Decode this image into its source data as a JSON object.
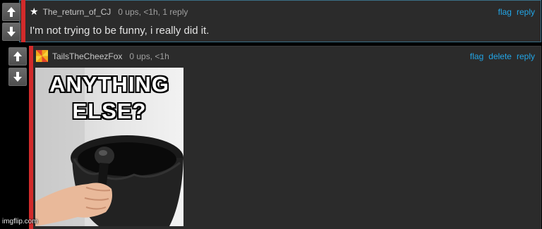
{
  "comments": [
    {
      "username": "The_return_of_CJ",
      "meta": "0 ups, <1h, 1 reply",
      "text": "I'm not trying to be funny, i really did it.",
      "actions": [
        "flag",
        "reply"
      ]
    },
    {
      "username": "TailsTheCheezFox",
      "meta": "0 ups, <1h",
      "actions": [
        "flag",
        "delete",
        "reply"
      ],
      "image": {
        "caption_line1": "ANYTHING",
        "caption_line2": "ELSE?",
        "watermark": "imgflip.com"
      }
    }
  ],
  "icons": {
    "upvote": "arrow-up-icon",
    "downvote": "arrow-down-icon",
    "badge": "star-icon",
    "avatar": "pinwheel-avatar-icon"
  },
  "colors": {
    "background": "#000000",
    "comment_bg": "#2b2b2b",
    "accent_red": "#d22b2b",
    "link_blue": "#22a5e6",
    "highlight_border": "#3b6f86"
  }
}
